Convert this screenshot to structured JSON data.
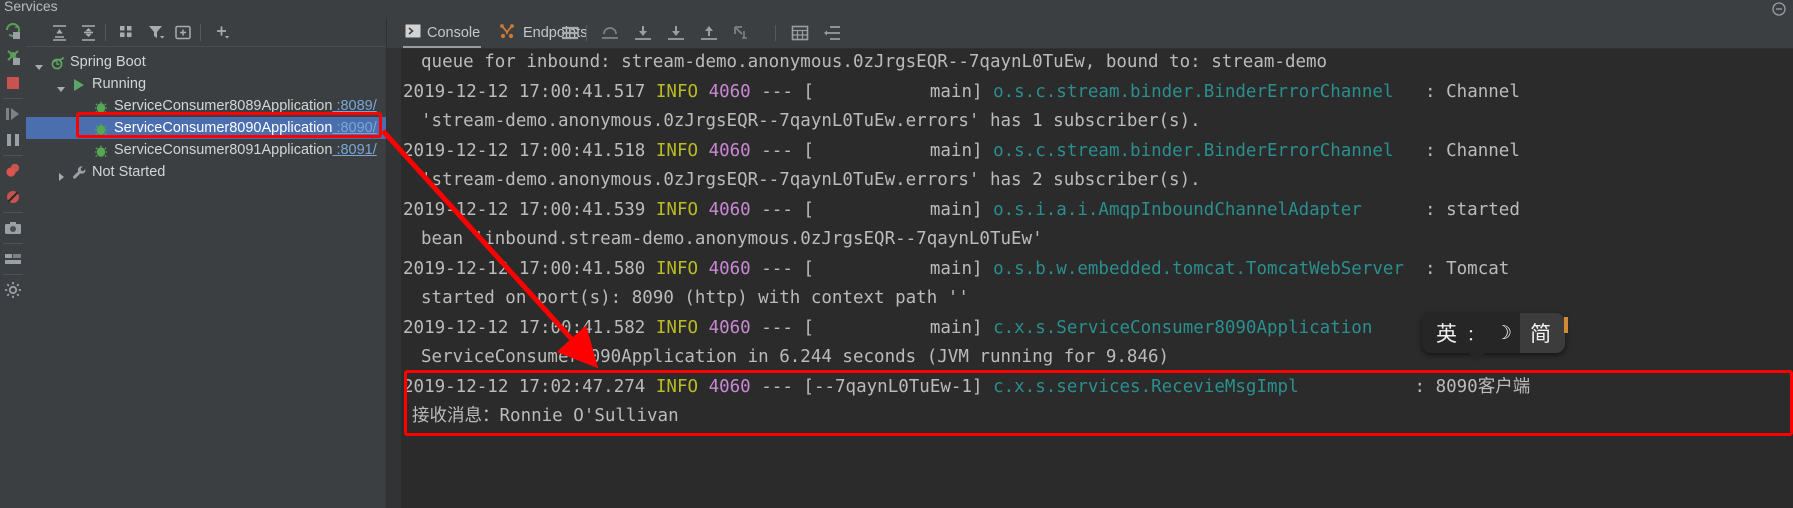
{
  "window": {
    "title": "Services",
    "hide_icon": "minimize-icon"
  },
  "left_rail": {
    "icons": [
      {
        "name": "rerun-icon"
      },
      {
        "name": "rerun-failed-tests-icon"
      },
      {
        "name": "stop-icon"
      },
      {
        "name": "resume-program-icon"
      },
      {
        "name": "pause-program-icon"
      },
      {
        "name": "view-breakpoints-icon"
      },
      {
        "name": "mute-breakpoints-icon"
      },
      {
        "name": "screenshot-icon"
      },
      {
        "name": "layout-icon"
      },
      {
        "name": "settings-icon"
      }
    ]
  },
  "tree_toolbar": {
    "icons": [
      {
        "name": "expand-all-icon"
      },
      {
        "name": "collapse-all-icon"
      },
      {
        "name": "group-by-icon"
      },
      {
        "name": "filter-icon"
      },
      {
        "name": "show-configurations-icon"
      },
      {
        "name": "add-service-icon"
      }
    ]
  },
  "tree": {
    "nodes": [
      {
        "label": "Spring Boot",
        "port": "",
        "icon": "spring-boot-icon",
        "twisty": "expanded",
        "depth": 0,
        "selected": false
      },
      {
        "label": "Running",
        "port": "",
        "icon": "run-green-icon",
        "twisty": "expanded",
        "depth": 1,
        "selected": false
      },
      {
        "label": "ServiceConsumer8089Application",
        "port": ":8089/",
        "icon": "spring-bean-icon",
        "twisty": "none",
        "depth": 2,
        "selected": false
      },
      {
        "label": "ServiceConsumer8090Application",
        "port": ":8090/",
        "icon": "spring-bean-icon",
        "twisty": "none",
        "depth": 2,
        "selected": true
      },
      {
        "label": "ServiceConsumer8091Application",
        "port": ":8091/",
        "icon": "spring-bean-icon",
        "twisty": "none",
        "depth": 2,
        "selected": false
      },
      {
        "label": "Not Started",
        "port": "",
        "icon": "wrench-icon",
        "twisty": "collapsed",
        "depth": 1,
        "selected": false
      }
    ]
  },
  "console_toolbar": {
    "tabs": [
      {
        "label": "Console",
        "icon": "console-icon",
        "active": true
      },
      {
        "label": "Endpoints",
        "icon": "endpoints-icon",
        "active": false
      }
    ],
    "icons": [
      {
        "name": "hamburger-menu-icon"
      },
      {
        "name": "step-out-icon"
      },
      {
        "name": "step-over-icon"
      },
      {
        "name": "step-into-icon"
      },
      {
        "name": "force-step-into-icon"
      },
      {
        "name": "run-to-cursor-icon"
      },
      {
        "name": "evaluate-table-icon"
      },
      {
        "name": "soft-wrap-icon"
      }
    ]
  },
  "console_log": {
    "lines": [
      {
        "indent": 2,
        "segments": [
          {
            "t": "queue for inbound: stream-demo.anonymous.0zJrgsEQR--7qaynL0TuEw, bound to: stream-demo",
            "c": "cont"
          }
        ]
      },
      {
        "indent": 0,
        "segments": [
          {
            "t": "2019-12-12 17:00:41.517 ",
            "c": "cont"
          },
          {
            "t": "INFO",
            "c": "lvl"
          },
          {
            "t": " ",
            "c": "cont"
          },
          {
            "t": "4060",
            "c": "pid"
          },
          {
            "t": " --- [           main] ",
            "c": "cont"
          },
          {
            "t": "o.s.c.stream.binder.BinderErrorChannel",
            "c": "lg"
          },
          {
            "t": "   : Channel",
            "c": "cont"
          }
        ]
      },
      {
        "indent": 2,
        "segments": [
          {
            "t": "'stream-demo.anonymous.0zJrgsEQR--7qaynL0TuEw.errors' has 1 subscriber(s).",
            "c": "cont"
          }
        ]
      },
      {
        "indent": 0,
        "segments": [
          {
            "t": "2019-12-12 17:00:41.518 ",
            "c": "cont"
          },
          {
            "t": "INFO",
            "c": "lvl"
          },
          {
            "t": " ",
            "c": "cont"
          },
          {
            "t": "4060",
            "c": "pid"
          },
          {
            "t": " --- [           main] ",
            "c": "cont"
          },
          {
            "t": "o.s.c.stream.binder.BinderErrorChannel",
            "c": "lg"
          },
          {
            "t": "   : Channel",
            "c": "cont"
          }
        ]
      },
      {
        "indent": 2,
        "segments": [
          {
            "t": "'stream-demo.anonymous.0zJrgsEQR--7qaynL0TuEw.errors' has 2 subscriber(s).",
            "c": "cont"
          }
        ]
      },
      {
        "indent": 0,
        "segments": [
          {
            "t": "2019-12-12 17:00:41.539 ",
            "c": "cont"
          },
          {
            "t": "INFO",
            "c": "lvl"
          },
          {
            "t": " ",
            "c": "cont"
          },
          {
            "t": "4060",
            "c": "pid"
          },
          {
            "t": " --- [           main] ",
            "c": "cont"
          },
          {
            "t": "o.s.i.a.i.AmqpInboundChannelAdapter",
            "c": "lg"
          },
          {
            "t": "      : started",
            "c": "cont"
          }
        ]
      },
      {
        "indent": 2,
        "segments": [
          {
            "t": "bean 'inbound.stream-demo.anonymous.0zJrgsEQR--7qaynL0TuEw'",
            "c": "cont"
          }
        ]
      },
      {
        "indent": 0,
        "segments": [
          {
            "t": "2019-12-12 17:00:41.580 ",
            "c": "cont"
          },
          {
            "t": "INFO",
            "c": "lvl"
          },
          {
            "t": " ",
            "c": "cont"
          },
          {
            "t": "4060",
            "c": "pid"
          },
          {
            "t": " --- [           main] ",
            "c": "cont"
          },
          {
            "t": "o.s.b.w.embedded.tomcat.TomcatWebServer",
            "c": "lg"
          },
          {
            "t": "  : Tomcat",
            "c": "cont"
          }
        ]
      },
      {
        "indent": 2,
        "segments": [
          {
            "t": "started on port(s): 8090 (http) with context path ''",
            "c": "cont"
          }
        ]
      },
      {
        "indent": 0,
        "segments": [
          {
            "t": "2019-12-12 17:00:41.582 ",
            "c": "cont"
          },
          {
            "t": "INFO",
            "c": "lvl"
          },
          {
            "t": " ",
            "c": "cont"
          },
          {
            "t": "4060",
            "c": "pid"
          },
          {
            "t": " --- [           main] ",
            "c": "cont"
          },
          {
            "t": "c.x.s.ServiceConsumer8090Application",
            "c": "lg"
          },
          {
            "t": "",
            "c": "cont"
          }
        ]
      },
      {
        "indent": 2,
        "segments": [
          {
            "t": "ServiceConsumer8090Application in 6.244 seconds (JVM running for 9.846)",
            "c": "cont"
          }
        ]
      },
      {
        "indent": 0,
        "segments": [
          {
            "t": "2019-12-12 17:02:47.274 ",
            "c": "cont"
          },
          {
            "t": "INFO",
            "c": "lvl"
          },
          {
            "t": " ",
            "c": "cont"
          },
          {
            "t": "4060",
            "c": "pid"
          },
          {
            "t": " --- [--7qaynL0TuEw-1] ",
            "c": "cont"
          },
          {
            "t": "c.x.s.services.RecevieMsgImpl",
            "c": "lg"
          },
          {
            "t": "           : 8090客户端",
            "c": "cont"
          }
        ]
      },
      {
        "indent": 1,
        "segments": [
          {
            "t": "接收消息：Ronnie O'Sullivan",
            "c": "cont"
          }
        ]
      }
    ]
  },
  "annotations": {
    "highlight_tree_row": "ServiceConsumer8090Application",
    "highlight_log_lines": "2019-12-12 17:02:47.274 / 接收消息：Ronnie O'Sullivan",
    "arrow": "red-arrow-pointing-to-ServiceConsumer8090Application-log-line",
    "box_color": "#ff0000"
  },
  "ime_popup": {
    "mode_label": "英",
    "punct_label": "：",
    "shape_label": "☽",
    "script_label": "简"
  }
}
